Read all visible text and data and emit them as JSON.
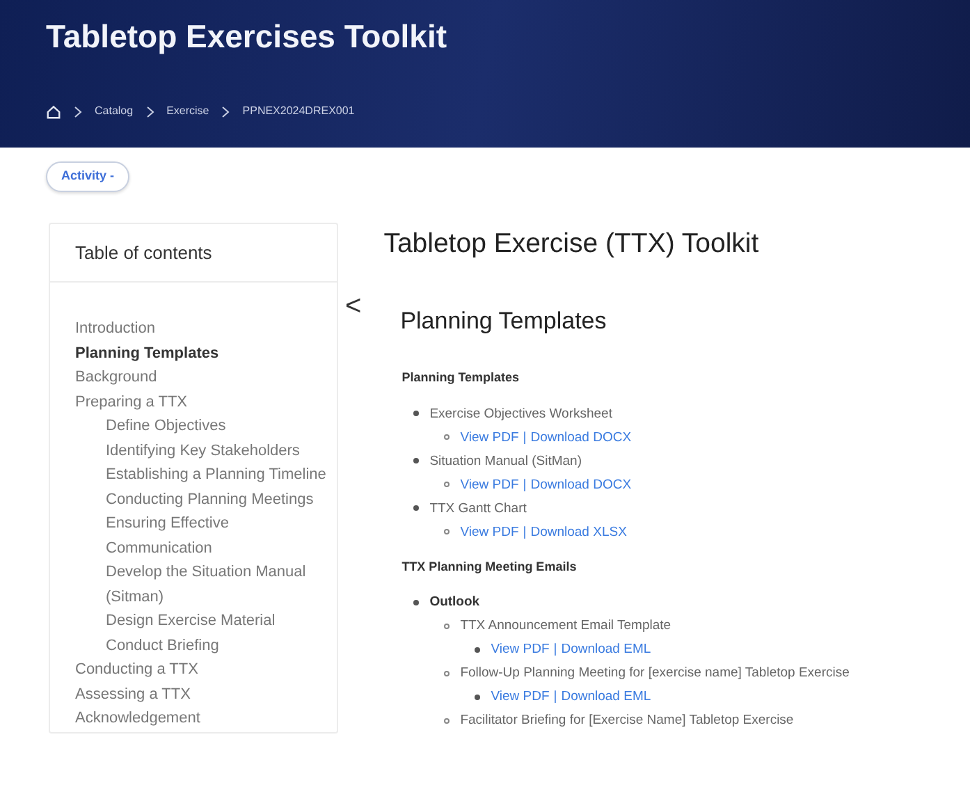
{
  "header": {
    "title": "Tabletop Exercises Toolkit",
    "breadcrumbs": [
      "Catalog",
      "Exercise",
      "PPNEX2024DREX001"
    ]
  },
  "activity_button": {
    "label": "Activity -"
  },
  "toc": {
    "title": "Table of contents",
    "items": [
      {
        "label": "Introduction",
        "selected": false
      },
      {
        "label": "Planning Templates",
        "selected": true
      },
      {
        "label": "Background",
        "selected": false
      },
      {
        "label": "Preparing a TTX",
        "selected": false,
        "children": [
          {
            "label": "Define Objectives",
            "selected": false
          },
          {
            "label": "Identifying Key Stakeholders",
            "selected": false
          },
          {
            "label": "Establishing a Planning Timeline",
            "selected": false
          },
          {
            "label": "Conducting Planning Meetings",
            "selected": false
          },
          {
            "label": "Ensuring Effective Communication",
            "selected": false
          },
          {
            "label": "Develop the Situation Manual (Sitman)",
            "selected": false
          },
          {
            "label": "Design Exercise Material",
            "selected": false
          },
          {
            "label": "Conduct Briefing",
            "selected": false
          }
        ]
      },
      {
        "label": "Conducting a TTX",
        "selected": false
      },
      {
        "label": "Assessing a TTX",
        "selected": false
      },
      {
        "label": "Acknowledgement",
        "selected": false
      }
    ]
  },
  "collapse_toggle": "<",
  "main": {
    "title": "Tabletop Exercise (TTX) Toolkit",
    "section_title": "Planning Templates",
    "groups": [
      {
        "heading": "Planning Templates",
        "items": [
          {
            "label": "Exercise Objectives Worksheet",
            "bold": false,
            "children": [
              {
                "links": [
                  "View PDF",
                  "Download DOCX"
                ],
                "separator": "|"
              }
            ]
          },
          {
            "label": "Situation Manual (SitMan)",
            "bold": false,
            "children": [
              {
                "links": [
                  "View PDF",
                  "Download DOCX"
                ],
                "separator": "|"
              }
            ]
          },
          {
            "label": "TTX Gantt Chart",
            "bold": false,
            "children": [
              {
                "links": [
                  "View PDF",
                  "Download XLSX"
                ],
                "separator": "|"
              }
            ]
          }
        ]
      },
      {
        "heading": "TTX Planning Meeting Emails",
        "items": [
          {
            "label": "Outlook",
            "bold": true,
            "children": [
              {
                "label": "TTX Announcement Email Template",
                "bold": false,
                "children": [
                  {
                    "links": [
                      "View PDF",
                      "Download EML"
                    ],
                    "separator": "|"
                  }
                ]
              },
              {
                "label": "Follow-Up Planning Meeting for [exercise name] Tabletop Exercise",
                "bold": false,
                "children": [
                  {
                    "links": [
                      "View PDF",
                      "Download EML"
                    ],
                    "separator": "|"
                  }
                ]
              },
              {
                "label": "Facilitator Briefing for [Exercise Name] Tabletop Exercise",
                "bold": false
              }
            ]
          }
        ]
      }
    ]
  }
}
